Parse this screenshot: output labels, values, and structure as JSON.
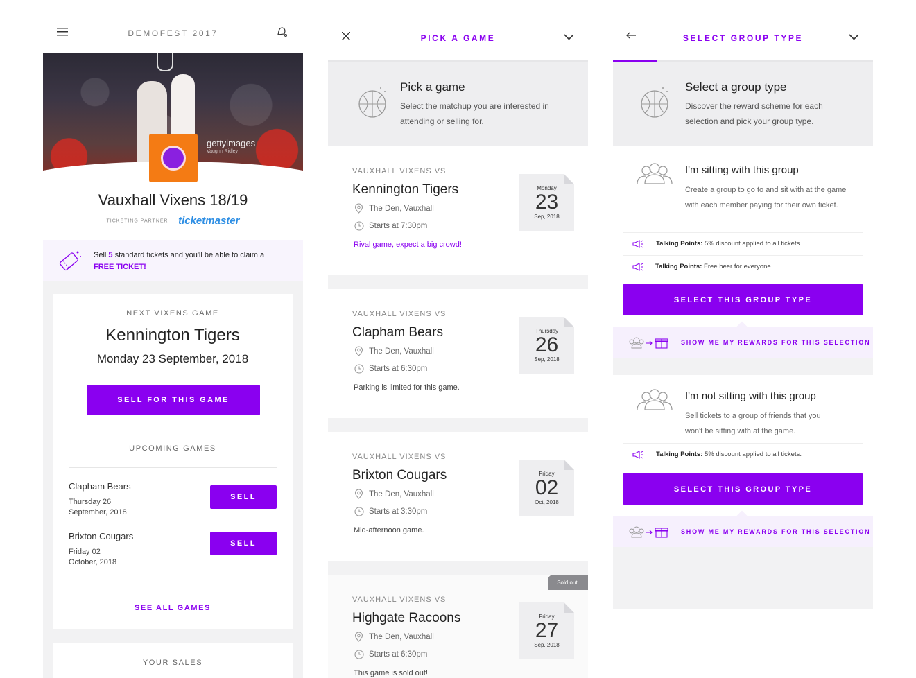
{
  "colors": {
    "accent": "#8a00f0",
    "partner": "#2f8fe4",
    "logo": "#f47b14"
  },
  "screen1": {
    "app_title": "DEMOFEST 2017",
    "icons": {
      "menu": "hamburger-menu-icon",
      "notify": "bell-icon"
    },
    "hero": {
      "watermark": "gettyimages",
      "credit": "Vaughn Ridley"
    },
    "team_title": "Vauxhall Vixens 18/19",
    "partner_label": "TICKETING PARTNER",
    "partner_name": "ticketmaster",
    "promo": {
      "pre": "Sell ",
      "count": "5",
      "post": " standard tickets and you'll be able to claim a",
      "reward": "FREE TICKET!"
    },
    "next_game": {
      "label": "NEXT VIXENS GAME",
      "team": "Kennington Tigers",
      "date": "Monday 23 September, 2018",
      "button": "SELL FOR THIS GAME"
    },
    "upcoming_label": "UPCOMING GAMES",
    "upcoming": [
      {
        "team": "Clapham Bears",
        "day": "Thursday 26",
        "month": "September, 2018",
        "button": "SELL"
      },
      {
        "team": "Brixton Cougars",
        "day": "Friday 02",
        "month": "October, 2018",
        "button": "SELL"
      }
    ],
    "see_all": "SEE ALL GAMES",
    "your_sales": "YOUR SALES"
  },
  "screen2": {
    "title": "PICK A GAME",
    "icons": {
      "close": "close-icon",
      "dropdown": "chevron-down-icon",
      "ball": "basketball-icon"
    },
    "header": {
      "title": "Pick a game",
      "subtitle": "Select the matchup you are interested in attending or selling for."
    },
    "games": [
      {
        "pre": "VAUXHALL VIXENS VS",
        "team": "Kennington Tigers",
        "venue": "The Den, Vauxhall",
        "time": "Starts at 7:30pm",
        "note": "Rival game, expect a big crowd!",
        "dow": "Monday",
        "day": "23",
        "month_year": "Sep, 2018"
      },
      {
        "pre": "VAUXHALL VIXENS VS",
        "team": "Clapham Bears",
        "venue": "The Den, Vauxhall",
        "time": "Starts at 6:30pm",
        "note": "Parking is limited for this game.",
        "dow": "Thursday",
        "day": "26",
        "month_year": "Sep, 2018"
      },
      {
        "pre": "VAUXHALL VIXENS VS",
        "team": "Brixton Cougars",
        "venue": "The Den, Vauxhall",
        "time": "Starts at 3:30pm",
        "note": "Mid-afternoon game.",
        "dow": "Friday",
        "day": "02",
        "month_year": "Oct, 2018"
      },
      {
        "pre": "VAUXHALL VIXENS VS",
        "team": "Highgate Racoons",
        "venue": "The Den, Vauxhall",
        "time": "Starts at 6:30pm",
        "note": "This game is sold out!",
        "dow": "Friday",
        "day": "27",
        "month_year": "Sep, 2018",
        "badge": "Sold out!"
      }
    ]
  },
  "screen3": {
    "title": "SELECT GROUP TYPE",
    "icons": {
      "back": "back-arrow-icon",
      "dropdown": "chevron-down-icon",
      "group": "group-icon",
      "megaphone": "megaphone-icon",
      "gift": "gift-icon"
    },
    "header": {
      "title": "Select a group type",
      "subtitle": "Discover the reward scheme for each selection and pick your group type."
    },
    "options": [
      {
        "title": "I'm sitting with this group",
        "desc": "Create a group to go to and sit with at the game with each member paying for their own ticket.",
        "points": [
          {
            "label": "Talking Points:",
            "text": " 5% discount applied to all tickets."
          },
          {
            "label": "Talking Points:",
            "text": " Free beer for everyone."
          }
        ],
        "button": "SELECT THIS GROUP TYPE",
        "rewards": "SHOW ME MY REWARDS FOR THIS SELECTION"
      },
      {
        "title": "I'm not sitting with this group",
        "desc": "Sell tickets to a group of friends that you won't be sitting with at the game.",
        "points": [
          {
            "label": "Talking Points:",
            "text": " 5% discount applied to all tickets."
          }
        ],
        "button": "SELECT THIS GROUP TYPE",
        "rewards": "SHOW ME MY REWARDS FOR THIS SELECTION"
      }
    ]
  }
}
